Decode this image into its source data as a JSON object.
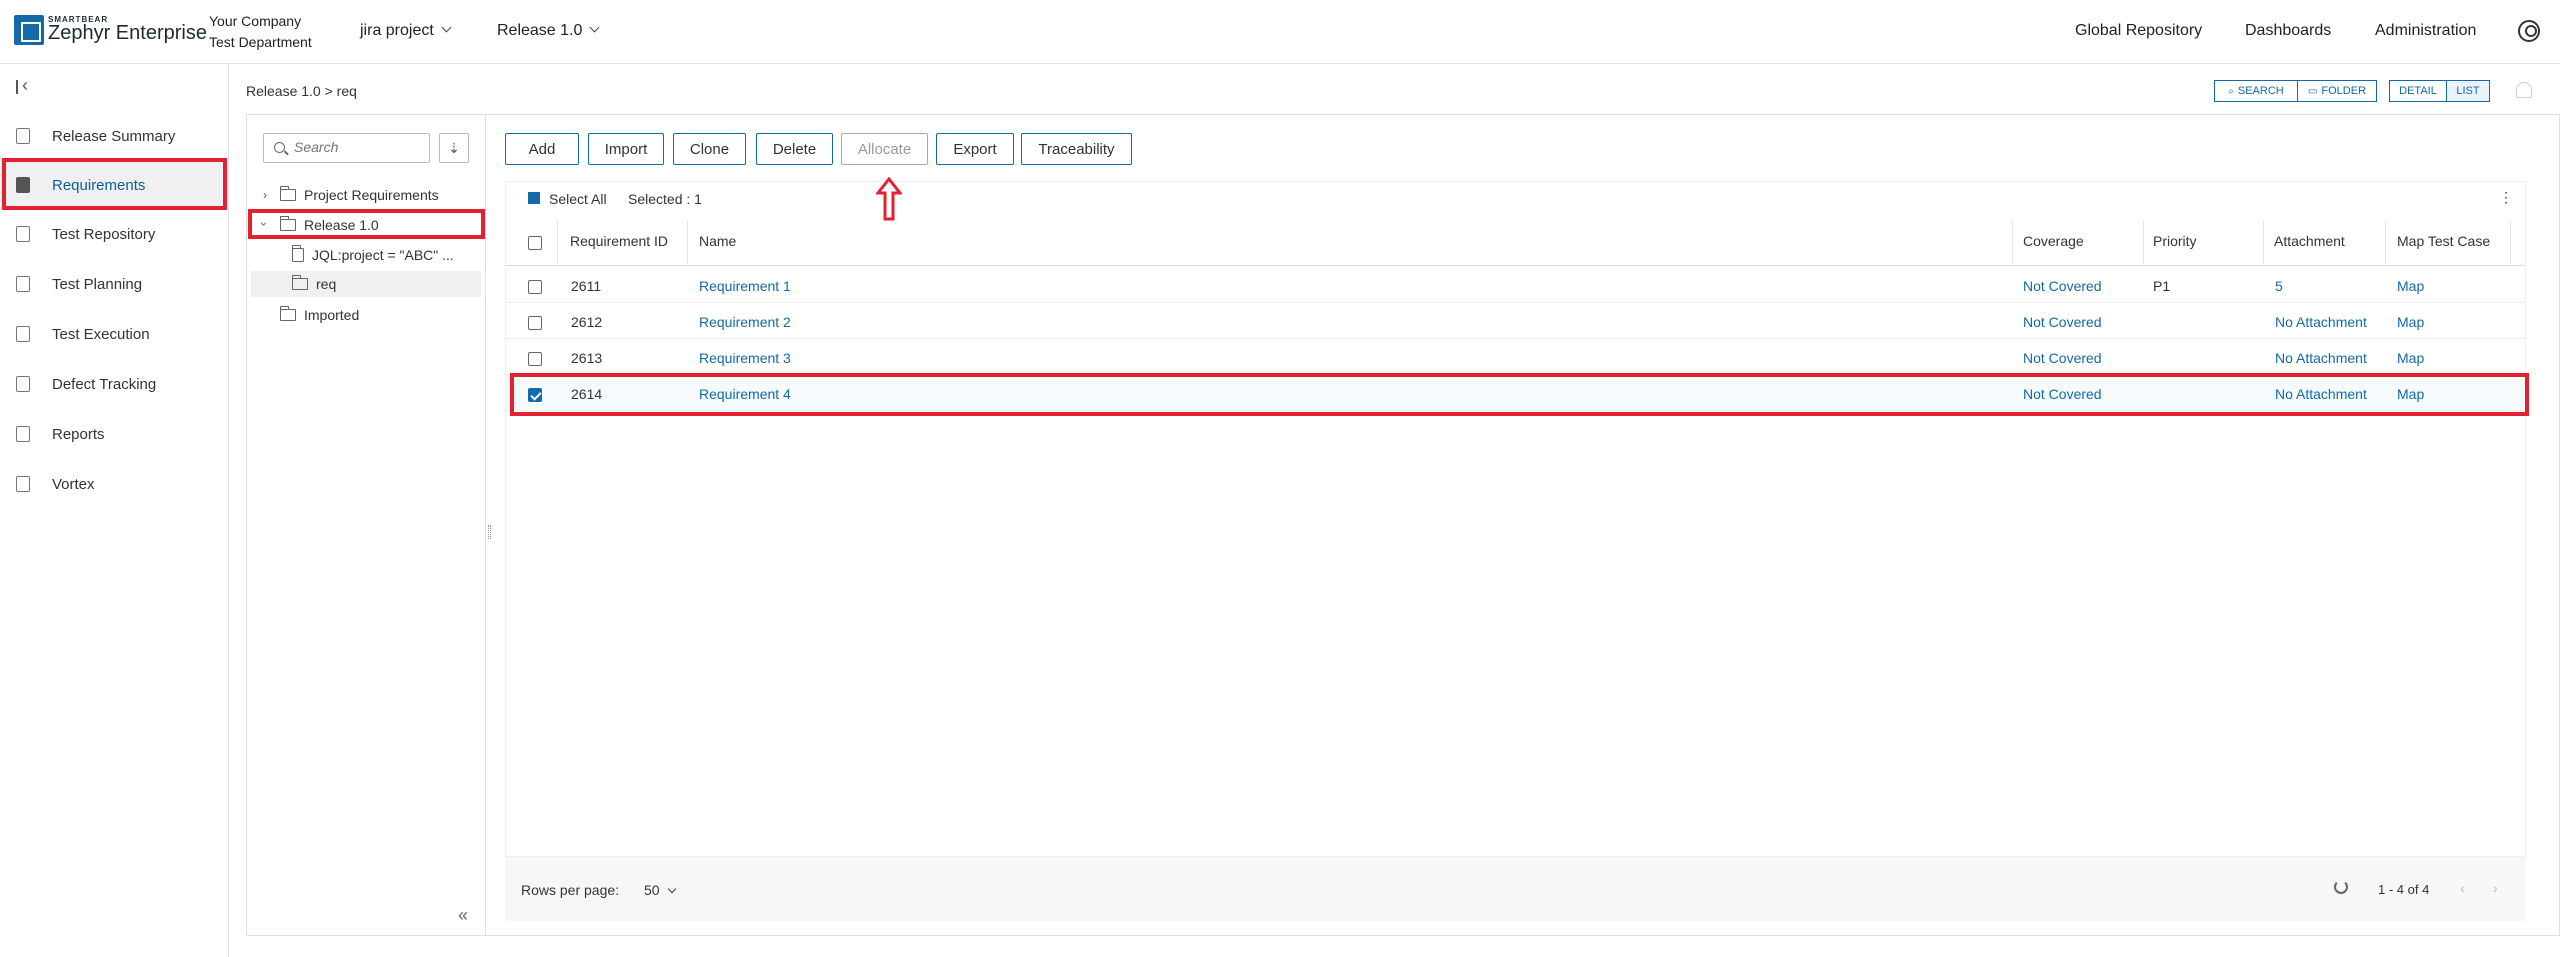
{
  "header": {
    "brand_small": "SMARTBEAR",
    "brand_main": "Zephyr Enterprise",
    "company": "Your Company",
    "department": "Test Department",
    "project_dropdown": "jira project",
    "release_dropdown": "Release 1.0",
    "nav": [
      "Global Repository",
      "Dashboards",
      "Administration"
    ]
  },
  "sidebar": {
    "items": [
      {
        "label": "Release Summary",
        "icon": "clipboard-icon"
      },
      {
        "label": "Requirements",
        "icon": "requirements-icon"
      },
      {
        "label": "Test Repository",
        "icon": "folder-open-icon"
      },
      {
        "label": "Test Planning",
        "icon": "calendar-icon"
      },
      {
        "label": "Test Execution",
        "icon": "execution-icon"
      },
      {
        "label": "Defect Tracking",
        "icon": "bug-icon"
      },
      {
        "label": "Reports",
        "icon": "chart-icon"
      },
      {
        "label": "Vortex",
        "icon": "vortex-icon"
      }
    ],
    "active": "Requirements"
  },
  "breadcrumb": "Release 1.0 > req",
  "toolbar": {
    "search": "SEARCH",
    "folder": "FOLDER",
    "detail": "DETAIL",
    "list": "LIST"
  },
  "tree": {
    "search_placeholder": "Search",
    "nodes": {
      "project_requirements": "Project Requirements",
      "release": "Release 1.0",
      "jql": "JQL:project = \"ABC\" ...",
      "req": "req",
      "imported": "Imported"
    }
  },
  "actions": {
    "add": "Add",
    "import": "Import",
    "clone": "Clone",
    "delete": "Delete",
    "allocate": "Allocate",
    "export": "Export",
    "traceability": "Traceability"
  },
  "grid": {
    "select_all": "Select All",
    "selected": "Selected : 1",
    "columns": [
      "Requirement ID",
      "Name",
      "Coverage",
      "Priority",
      "Attachment",
      "Map Test Case"
    ],
    "rows": [
      {
        "id": "2611",
        "name": "Requirement 1",
        "coverage": "Not Covered",
        "priority": "P1",
        "attachment": "5",
        "map": "Map",
        "checked": false
      },
      {
        "id": "2612",
        "name": "Requirement 2",
        "coverage": "Not Covered",
        "priority": "",
        "attachment": "No Attachment",
        "map": "Map",
        "checked": false
      },
      {
        "id": "2613",
        "name": "Requirement 3",
        "coverage": "Not Covered",
        "priority": "",
        "attachment": "No Attachment",
        "map": "Map",
        "checked": false
      },
      {
        "id": "2614",
        "name": "Requirement 4",
        "coverage": "Not Covered",
        "priority": "",
        "attachment": "No Attachment",
        "map": "Map",
        "checked": true
      }
    ],
    "rows_per_page_label": "Rows per page:",
    "rows_per_page": "50",
    "range": "1 - 4 of 4"
  },
  "colors": {
    "accent": "#1469a8",
    "highlight": "#e32231"
  }
}
